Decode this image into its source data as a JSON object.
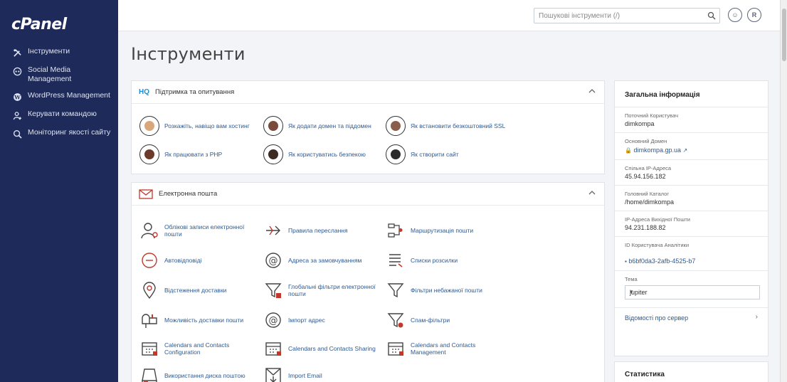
{
  "brand": {
    "logo_text": "cPanel"
  },
  "sidebar": {
    "items": [
      {
        "label": "Інструменти",
        "icon": "tools-icon"
      },
      {
        "label": "Social Media Management",
        "icon": "social-media-icon"
      },
      {
        "label": "WordPress Management",
        "icon": "wordpress-icon"
      },
      {
        "label": "Керувати командою",
        "icon": "team-icon"
      },
      {
        "label": "Моніторинг якості сайту",
        "icon": "site-quality-icon"
      }
    ]
  },
  "topbar": {
    "search_placeholder": "Пошукові інструменти (/)",
    "user_button": "☺",
    "logout_button": "R"
  },
  "main": {
    "title": "Інструменти",
    "support_panel": {
      "badge": "HQ",
      "title": "Підтримка та опитування",
      "tools": [
        {
          "label": "Розкажіть, навіщо вам хостинг"
        },
        {
          "label": "Як додати домен та піддомен"
        },
        {
          "label": "Як встановити безкоштовний SSL"
        },
        {
          "label": "Як працювати з PHP"
        },
        {
          "label": "Як користуватись безпекою"
        },
        {
          "label": "Як створити сайт"
        }
      ]
    },
    "email_panel": {
      "title": "Електронна пошта",
      "tools": [
        {
          "label": "Облікові записи електронної пошти"
        },
        {
          "label": "Правила переслання"
        },
        {
          "label": "Маршрутизація пошти"
        },
        {
          "label": "Автовідповіді"
        },
        {
          "label": "Адреса за замовчуванням"
        },
        {
          "label": "Списки розсилки"
        },
        {
          "label": "Відстеження доставки"
        },
        {
          "label": "Глобальні фільтри електронної пошти"
        },
        {
          "label": "Фільтри небажаної пошти"
        },
        {
          "label": "Можливість доставки пошти"
        },
        {
          "label": "Імпорт адрес"
        },
        {
          "label": "Спам-фільтри"
        },
        {
          "label": "Calendars and Contacts Configuration"
        },
        {
          "label": "Calendars and Contacts Sharing"
        },
        {
          "label": "Calendars and Contacts Management"
        },
        {
          "label": "Використання диска поштою"
        },
        {
          "label": "Import Email"
        }
      ]
    }
  },
  "info": {
    "title": "Загальна інформація",
    "current_user_label": "Поточний Користувач",
    "current_user": "dimkompa",
    "primary_domain_label": "Основний Домен",
    "primary_domain": "dimkompa.gp.ua",
    "shared_ip_label": "Спільна IP-Адреса",
    "shared_ip": "45.94.156.182",
    "home_dir_label": "Головний Каталог",
    "home_dir": "/home/dimkompa",
    "outgoing_ip_label": "IP-Адреса Вихідної Пошти",
    "outgoing_ip": "94.231.188.82",
    "user_analytics_label": "ID Користувача Аналітики",
    "user_analytics": "b6bf0da3-2afb-4525-b7",
    "theme_label": "Тема",
    "theme": "jupiter",
    "server_info_link": "Відомості про сервер",
    "stats_title": "Статистика"
  },
  "colors": {
    "sidebar_bg": "#1e2a5a",
    "link": "#2c5a93",
    "hq_badge": "#1a8fd6",
    "mail_red": "#c0392b"
  }
}
